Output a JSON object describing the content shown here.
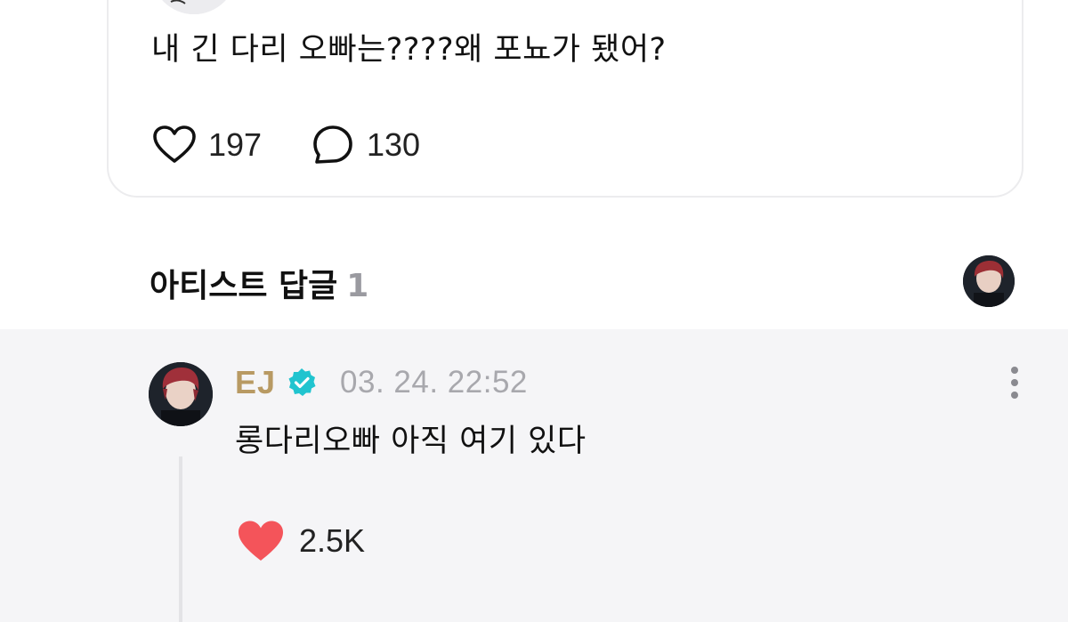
{
  "post": {
    "text": "내 긴 다리 오빠는????왜 포뇨가 됐어?",
    "like_count": "197",
    "comment_count": "130"
  },
  "artist_replies": {
    "title": "아티스트 답글",
    "count": "1"
  },
  "reply": {
    "author": "EJ",
    "timestamp": "03. 24. 22:52",
    "text": "롱다리오빠 아직 여기 있다",
    "like_count": "2.5K"
  },
  "icons": {
    "like": "heart-outline-icon",
    "comment": "speech-bubble-icon",
    "verified": "verified-badge-icon",
    "more": "more-vertical-icon",
    "reply_like": "heart-filled-icon"
  },
  "colors": {
    "author_name": "#b89a63",
    "verified_badge": "#20c4cf",
    "liked_heart": "#f4545a",
    "timestamp": "#a8a8ad",
    "reply_background": "#f5f5f7",
    "count_muted": "#9a9aa0"
  }
}
